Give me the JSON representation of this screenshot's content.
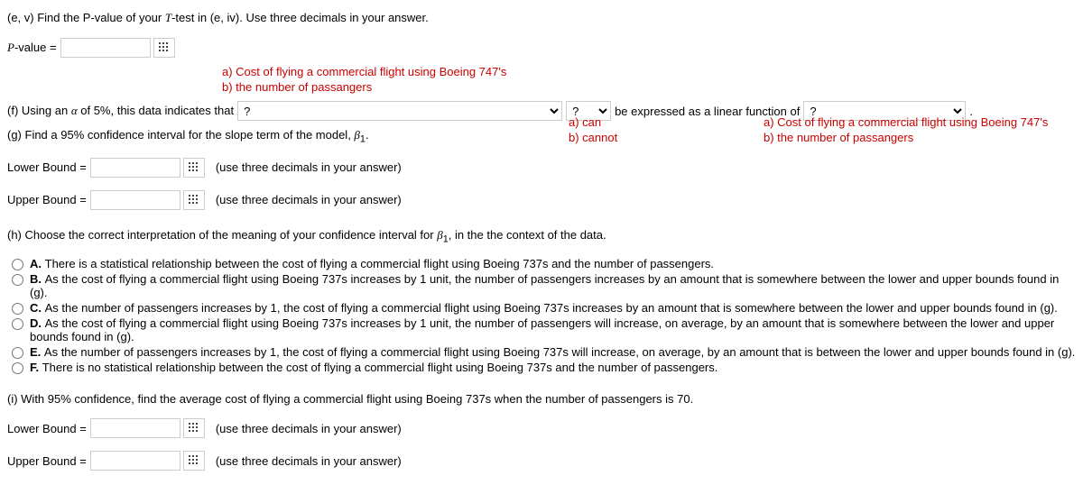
{
  "e_v": {
    "prompt_pre": "(e, v) Find the P-value of your ",
    "var": "T",
    "prompt_post": "-test in (e, iv). Use three decimals in your answer.",
    "label_pre": "P",
    "label_post": "-value ="
  },
  "f": {
    "annot_a": "a) Cost of flying a commercial flight using Boeing 747's",
    "annot_b": "b) the number of passangers",
    "pre": "(f) Using an ",
    "alpha": "α",
    "mid": " of 5%, this data indicates that",
    "sel1_ph": "?",
    "sel2_ph": "?",
    "mid2": "be expressed as a linear function of",
    "sel3_ph": "?",
    "period": ".",
    "annot2_a": "a) can",
    "annot2_b": "b) cannot",
    "annot3_a": "a) Cost of flying a commercial flight using Boeing 747's",
    "annot3_b": "b) the number of passangers"
  },
  "g": {
    "pre": "(g) Find a 95% confidence interval for the slope term of the model, ",
    "beta": "β",
    "sub": "1",
    "period": ".",
    "lower_label": "Lower Bound =",
    "upper_label": "Upper Bound =",
    "hint": "(use three decimals in your answer)"
  },
  "h": {
    "pre": "(h) Choose the correct interpretation of the meaning of your confidence interval for ",
    "beta": "β",
    "sub": "1",
    "post": ", in the the context of the data.",
    "options": [
      {
        "letter": "A.",
        "text": "There is a statistical relationship between the cost of flying a commercial flight using Boeing 737s and the number of passengers."
      },
      {
        "letter": "B.",
        "text": "As the cost of flying a commercial flight using Boeing 737s increases by 1 unit, the number of passengers increases by an amount that is somewhere between the lower and upper bounds found in (g)."
      },
      {
        "letter": "C.",
        "text": "As the number of passengers increases by 1, the cost of flying a commercial flight using Boeing 737s increases by an amount that is somewhere between the lower and upper bounds found in (g)."
      },
      {
        "letter": "D.",
        "text": "As the cost of flying a commercial flight using Boeing 737s increases by 1 unit, the number of passengers will increase, on average, by an amount that is somewhere between the lower and upper bounds found in (g)."
      },
      {
        "letter": "E.",
        "text": "As the number of passengers increases by 1, the cost of flying a commercial flight using Boeing 737s will increase, on average, by an amount that is between the lower and upper bounds found in (g)."
      },
      {
        "letter": "F.",
        "text": "There is no statistical relationship between the cost of flying a commercial flight using Boeing 737s and the number of passengers."
      }
    ]
  },
  "i": {
    "prompt": "(i) With 95% confidence, find the average cost of flying a commercial flight using Boeing 737s when the number of passengers is 70.",
    "lower_label": "Lower Bound =",
    "upper_label": "Upper Bound =",
    "hint": "(use three decimals in your answer)"
  }
}
